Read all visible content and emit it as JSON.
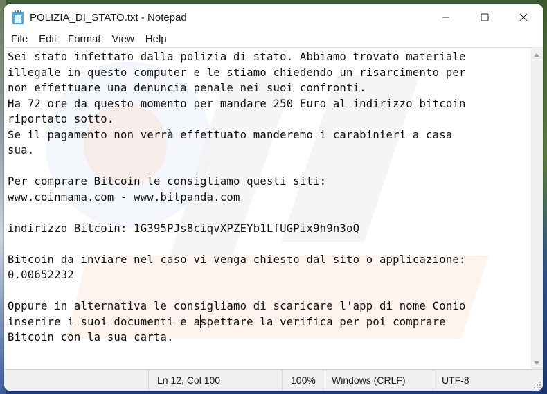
{
  "window": {
    "title": "POLIZIA_DI_STATO.txt - Notepad",
    "controls": [
      "minimize",
      "maximize",
      "close"
    ]
  },
  "menu": {
    "items": [
      {
        "label": "File"
      },
      {
        "label": "Edit"
      },
      {
        "label": "Format"
      },
      {
        "label": "View"
      },
      {
        "label": "Help"
      }
    ]
  },
  "editor": {
    "lines": [
      "Sei stato infettato dalla polizia di stato. Abbiamo trovato materiale",
      "illegale in questo computer e le stiamo chiedendo un risarcimento per",
      "non effettuare una denuncia penale nei suoi confronti.",
      "Ha 72 ore da questo momento per mandare 250 Euro al indirizzo bitcoin",
      "riportato sotto.",
      "Se il pagamento non verrà effettuato manderemo i carabinieri a casa",
      "sua.",
      "",
      "Per comprare Bitcoin le consigliamo questi siti:",
      "www.coinmama.com - www.bitpanda.com",
      "",
      "indirizzo Bitcoin: 1G395PJs8ciqvXPZEYb1LfUGPix9h9n3oQ",
      "",
      "Bitcoin da inviare nel caso vi venga chiesto dal sito o applicazione:",
      "0.00652232",
      "",
      "Oppure in alternativa le consigliamo di scaricare l'app di nome Conio",
      "inserire i suoi documenti e a",
      "spettare la verifica per poi comprare",
      "Bitcoin con la sua carta."
    ]
  },
  "statusbar": {
    "position": "Ln 12, Col 100",
    "zoom": "100%",
    "line_ending": "Windows (CRLF)",
    "encoding": "UTF-8"
  },
  "colors": {
    "window_bg": "#ffffff",
    "statusbar_bg": "#f0f0f0",
    "icon_blue": "#5aa8d8"
  }
}
